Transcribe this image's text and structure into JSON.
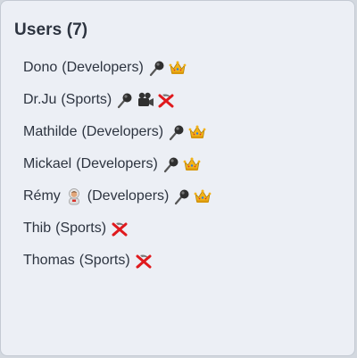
{
  "header": {
    "title": "Users (7)"
  },
  "users": [
    {
      "name": "Dono",
      "group": "(Developers)",
      "avatar": null,
      "icons": [
        "microphone-icon",
        "crown-icon"
      ]
    },
    {
      "name": "Dr.Ju",
      "group": "(Sports)",
      "avatar": null,
      "icons": [
        "microphone-icon",
        "video-camera-icon",
        "pickaxe-cross-icon"
      ]
    },
    {
      "name": "Mathilde",
      "group": "(Developers)",
      "avatar": null,
      "icons": [
        "microphone-icon",
        "crown-icon"
      ]
    },
    {
      "name": "Mickael",
      "group": "(Developers)",
      "avatar": null,
      "icons": [
        "microphone-icon",
        "crown-icon"
      ]
    },
    {
      "name": "Rémy",
      "group": "(Developers)",
      "avatar": "astronaut-icon",
      "icons": [
        "microphone-icon",
        "crown-icon"
      ]
    },
    {
      "name": "Thib",
      "group": "(Sports)",
      "avatar": null,
      "icons": [
        "pickaxe-cross-icon"
      ]
    },
    {
      "name": "Thomas",
      "group": "(Sports)",
      "avatar": null,
      "icons": [
        "pickaxe-cross-icon"
      ]
    }
  ]
}
